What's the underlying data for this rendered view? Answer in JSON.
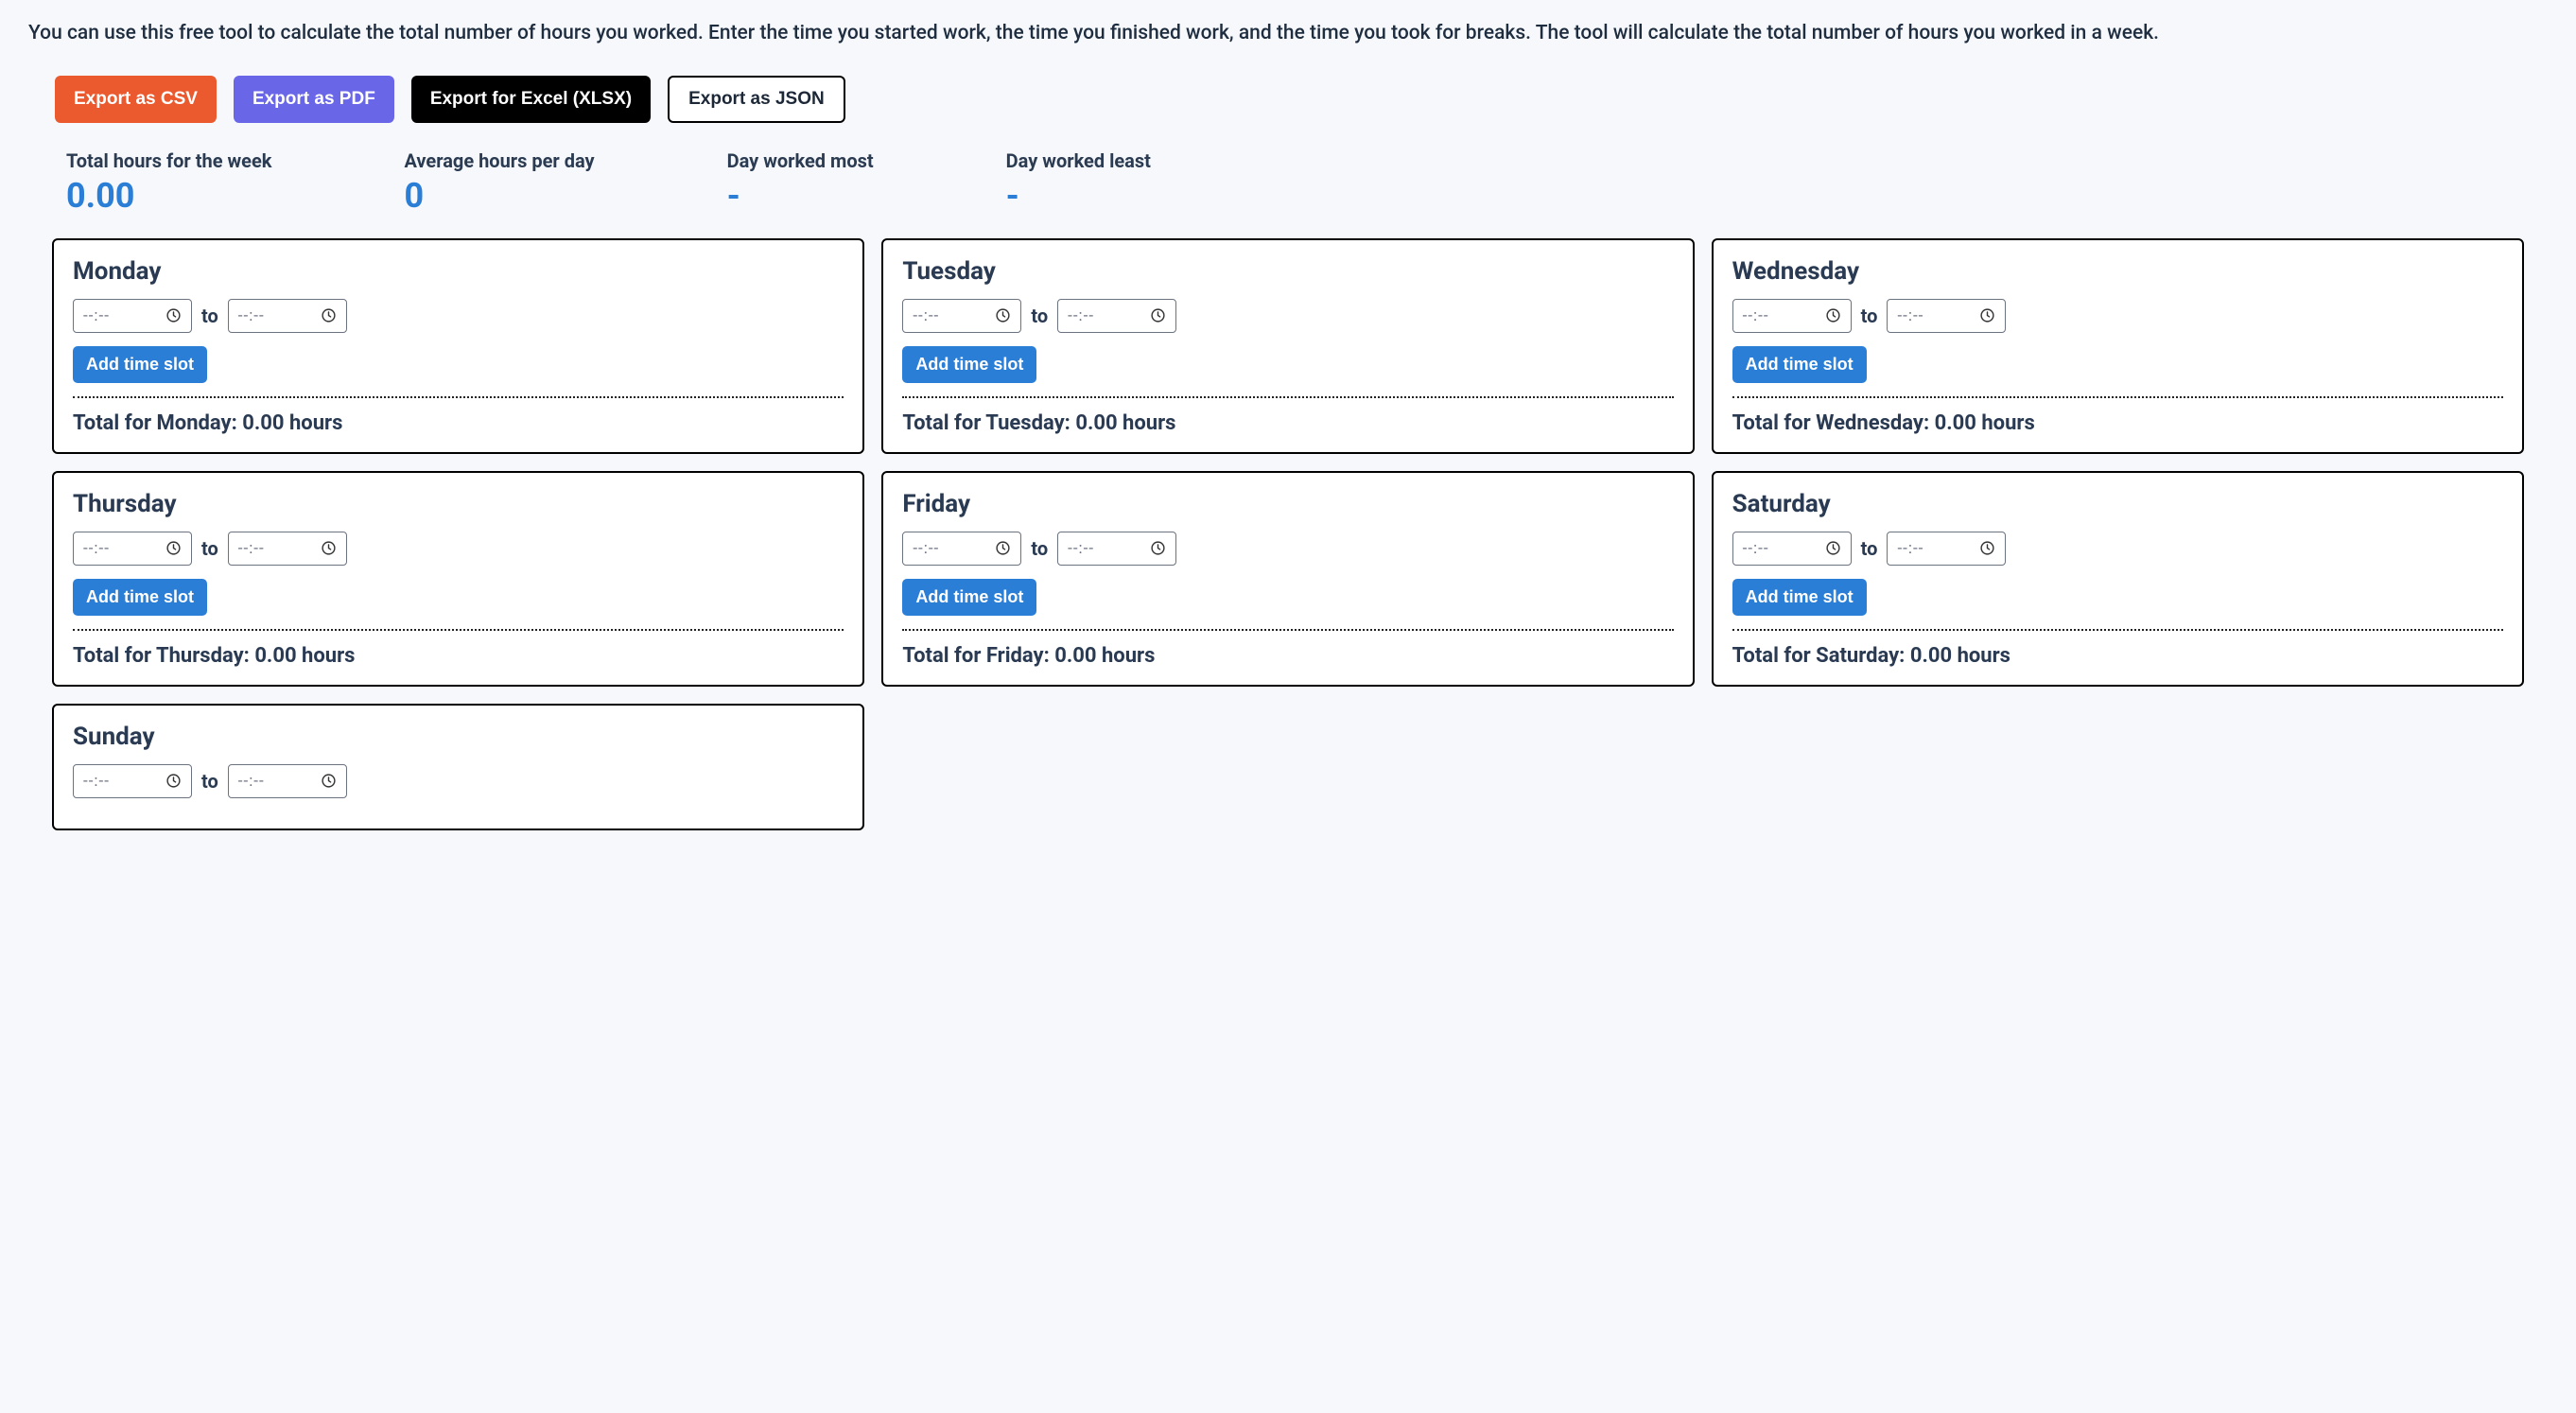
{
  "intro": "You can use this free tool to calculate the total number of hours you worked. Enter the time you started work, the time you finished work, and the time you took for breaks. The tool will calculate the total number of hours you worked in a week.",
  "export": {
    "csv": "Export as CSV",
    "pdf": "Export as PDF",
    "xlsx": "Export for Excel (XLSX)",
    "json": "Export as JSON"
  },
  "stats": {
    "total_label": "Total hours for the week",
    "total_value": "0.00",
    "avg_label": "Average hours per day",
    "avg_value": "0",
    "most_label": "Day worked most",
    "most_value": "-",
    "least_label": "Day worked least",
    "least_value": "-"
  },
  "common": {
    "to": "to",
    "add_slot": "Add time slot",
    "time_placeholder": "--:--"
  },
  "days": [
    {
      "name": "Monday",
      "total": "Total for Monday: 0.00 hours"
    },
    {
      "name": "Tuesday",
      "total": "Total for Tuesday: 0.00 hours"
    },
    {
      "name": "Wednesday",
      "total": "Total for Wednesday: 0.00 hours"
    },
    {
      "name": "Thursday",
      "total": "Total for Thursday: 0.00 hours"
    },
    {
      "name": "Friday",
      "total": "Total for Friday: 0.00 hours"
    },
    {
      "name": "Saturday",
      "total": "Total for Saturday: 0.00 hours"
    },
    {
      "name": "Sunday",
      "total": ""
    }
  ]
}
